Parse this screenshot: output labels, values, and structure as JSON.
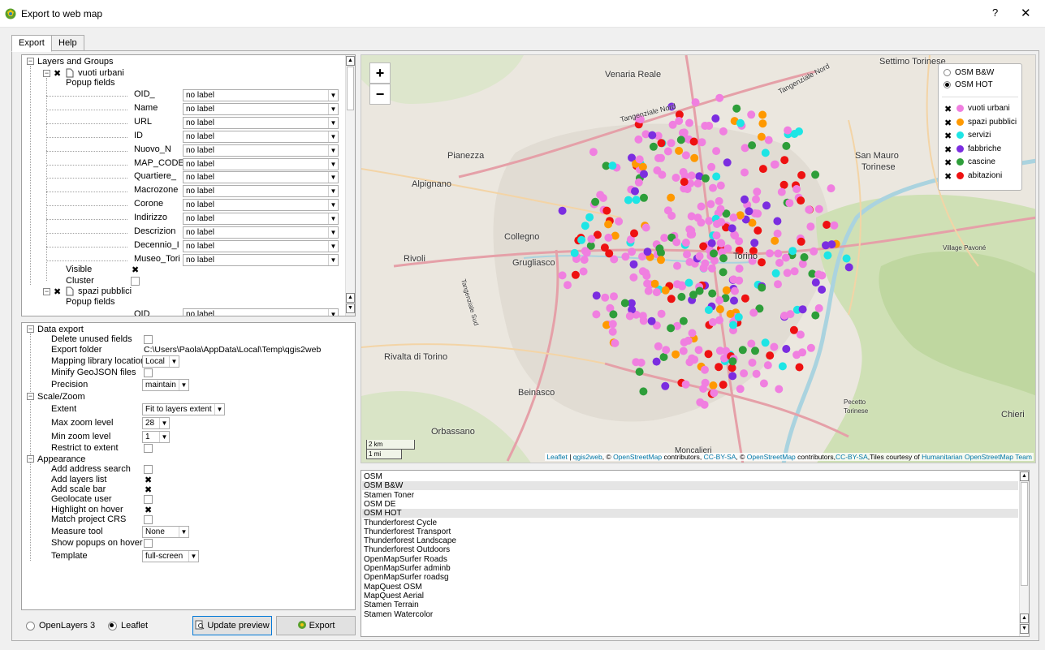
{
  "window": {
    "title": "Export to web map",
    "help_glyph": "?",
    "close_glyph": "✕"
  },
  "tabs": [
    {
      "label": "Export"
    },
    {
      "label": "Help"
    }
  ],
  "layers_tree": {
    "root_label": "Layers and Groups",
    "layer1": {
      "name": "vuoti urbani",
      "popup_label": "Popup fields",
      "fields": [
        {
          "name": "OID_",
          "value": "no label"
        },
        {
          "name": "Name",
          "value": "no label"
        },
        {
          "name": "URL",
          "value": "no label"
        },
        {
          "name": "ID",
          "value": "no label"
        },
        {
          "name": "Nuovo_N",
          "value": "no label"
        },
        {
          "name": "MAP_CODE_I",
          "value": "no label"
        },
        {
          "name": "Quartiere_",
          "value": "no label"
        },
        {
          "name": "Macrozone",
          "value": "no label"
        },
        {
          "name": "Corone",
          "value": "no label"
        },
        {
          "name": "Indirizzo",
          "value": "no label"
        },
        {
          "name": "Descrizion",
          "value": "no label"
        },
        {
          "name": "Decennio_I",
          "value": "no label"
        },
        {
          "name": "Museo_Tori",
          "value": "no label"
        }
      ],
      "visible_label": "Visible",
      "cluster_label": "Cluster"
    },
    "layer2": {
      "name": "spazi pubblici",
      "popup_label": "Popup fields",
      "field1": {
        "name": "OID",
        "value": "no label"
      }
    }
  },
  "settings": {
    "data_export": "Data export",
    "delete_unused": "Delete unused fields",
    "export_folder": "Export folder",
    "export_folder_value": "C:\\Users\\Paola\\AppData\\Local\\Temp\\qgis2web",
    "mapping_location": "Mapping library location",
    "mapping_location_value": "Local",
    "minify": "Minify GeoJSON files",
    "precision": "Precision",
    "precision_value": "maintain",
    "scale_zoom": "Scale/Zoom",
    "extent": "Extent",
    "extent_value": "Fit to layers extent",
    "max_zoom": "Max zoom level",
    "max_zoom_value": "28",
    "min_zoom": "Min zoom level",
    "min_zoom_value": "1",
    "restrict": "Restrict to extent",
    "appearance": "Appearance",
    "address_search": "Add address search",
    "layers_list": "Add layers list",
    "scale_bar": "Add scale bar",
    "geolocate": "Geolocate user",
    "highlight": "Highlight on hover",
    "match_crs": "Match project CRS",
    "measure": "Measure tool",
    "measure_value": "None",
    "popups_hover": "Show popups on hover",
    "template": "Template",
    "template_value": "full-screen"
  },
  "bottom": {
    "openlayers": "OpenLayers 3",
    "leaflet": "Leaflet",
    "update_preview": "Update preview",
    "export": "Export"
  },
  "map": {
    "zoom_in": "+",
    "zoom_out": "−",
    "places": [
      "Settimo Torinese",
      "Venaria Reale",
      "Tangenziale Nord",
      "Tangenziale Nord",
      "Pianezza",
      "San Mauro",
      "Torinese",
      "Alpignano",
      "Collegno",
      "Rivoli",
      "Grugliasco",
      "Torino",
      "Village Pavoné",
      "Tangenziale Sud",
      "Rivalta di Torino",
      "Beinasco",
      "Orbassano",
      "Pecetto",
      "Torinese",
      "Chieri",
      "Moncalieri"
    ],
    "scale_km": "2 km",
    "scale_mi": "1 mi",
    "attribution": {
      "leaflet": "Leaflet",
      "sep1": " | ",
      "qgis2web": "qgis2web",
      "t1": ", © ",
      "osm1": "OpenStreetMap",
      "t2": " contributors, ",
      "cc1": "CC-BY-SA",
      "t3": ", © ",
      "osm2": "OpenStreetMap",
      "t4": " contributors,",
      "cc2": "CC-BY-SA",
      "t5": ",Tiles courtesy of ",
      "hot": "Humanitarian OpenStreetMap Team"
    },
    "legend": {
      "basemaps": [
        "OSM B&W",
        "OSM HOT"
      ],
      "layers": [
        {
          "name": "vuoti urbani",
          "color": "#f07fe0"
        },
        {
          "name": "spazi pubblici",
          "color": "#ff9900"
        },
        {
          "name": "servizi",
          "color": "#1de5e5"
        },
        {
          "name": "fabbriche",
          "color": "#7b2de0"
        },
        {
          "name": "cascine",
          "color": "#2e9e3a"
        },
        {
          "name": "abitazioni",
          "color": "#ee1111"
        }
      ]
    }
  },
  "basemaps_list": [
    "OSM",
    "OSM B&W",
    "Stamen Toner",
    "OSM DE",
    "OSM HOT",
    "Thunderforest Cycle",
    "Thunderforest Transport",
    "Thunderforest Landscape",
    "Thunderforest Outdoors",
    "OpenMapSurfer Roads",
    "OpenMapSurfer adminb",
    "OpenMapSurfer roadsg",
    "MapQuest OSM",
    "MapQuest Aerial",
    "Stamen Terrain",
    "Stamen Watercolor"
  ]
}
